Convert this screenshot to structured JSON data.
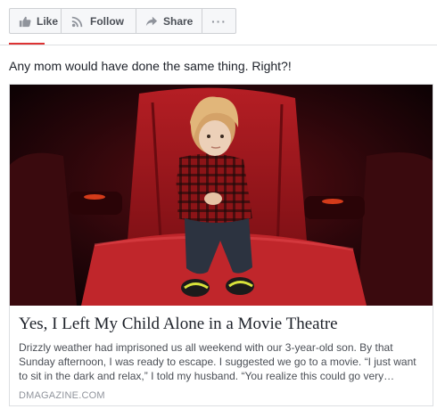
{
  "actions": {
    "like_label": "Like",
    "follow_label": "Follow",
    "share_label": "Share",
    "more_label": "···"
  },
  "icons": {
    "like": "thumbs-up-icon",
    "follow": "rss-icon",
    "share": "share-arrow-icon",
    "more": "more-dots-icon"
  },
  "colors": {
    "accent": "#dd3333",
    "border": "#ced0d4",
    "muted_text": "#90949c"
  },
  "post": {
    "caption": "Any mom would have done the same thing. Right?!",
    "card": {
      "image_alt": "Child sitting alone in a red movie theatre seat",
      "title": "Yes, I Left My Child Alone in a Movie Theatre",
      "description": "Drizzly weather had imprisoned us all weekend with our 3-year-old son. By that Sunday afternoon, I was ready to escape. I suggested we go to a movie. “I just want to sit in the dark and relax,” I told my husband. “You realize this could go very…",
      "domain": "DMAGAZINE.COM"
    }
  }
}
